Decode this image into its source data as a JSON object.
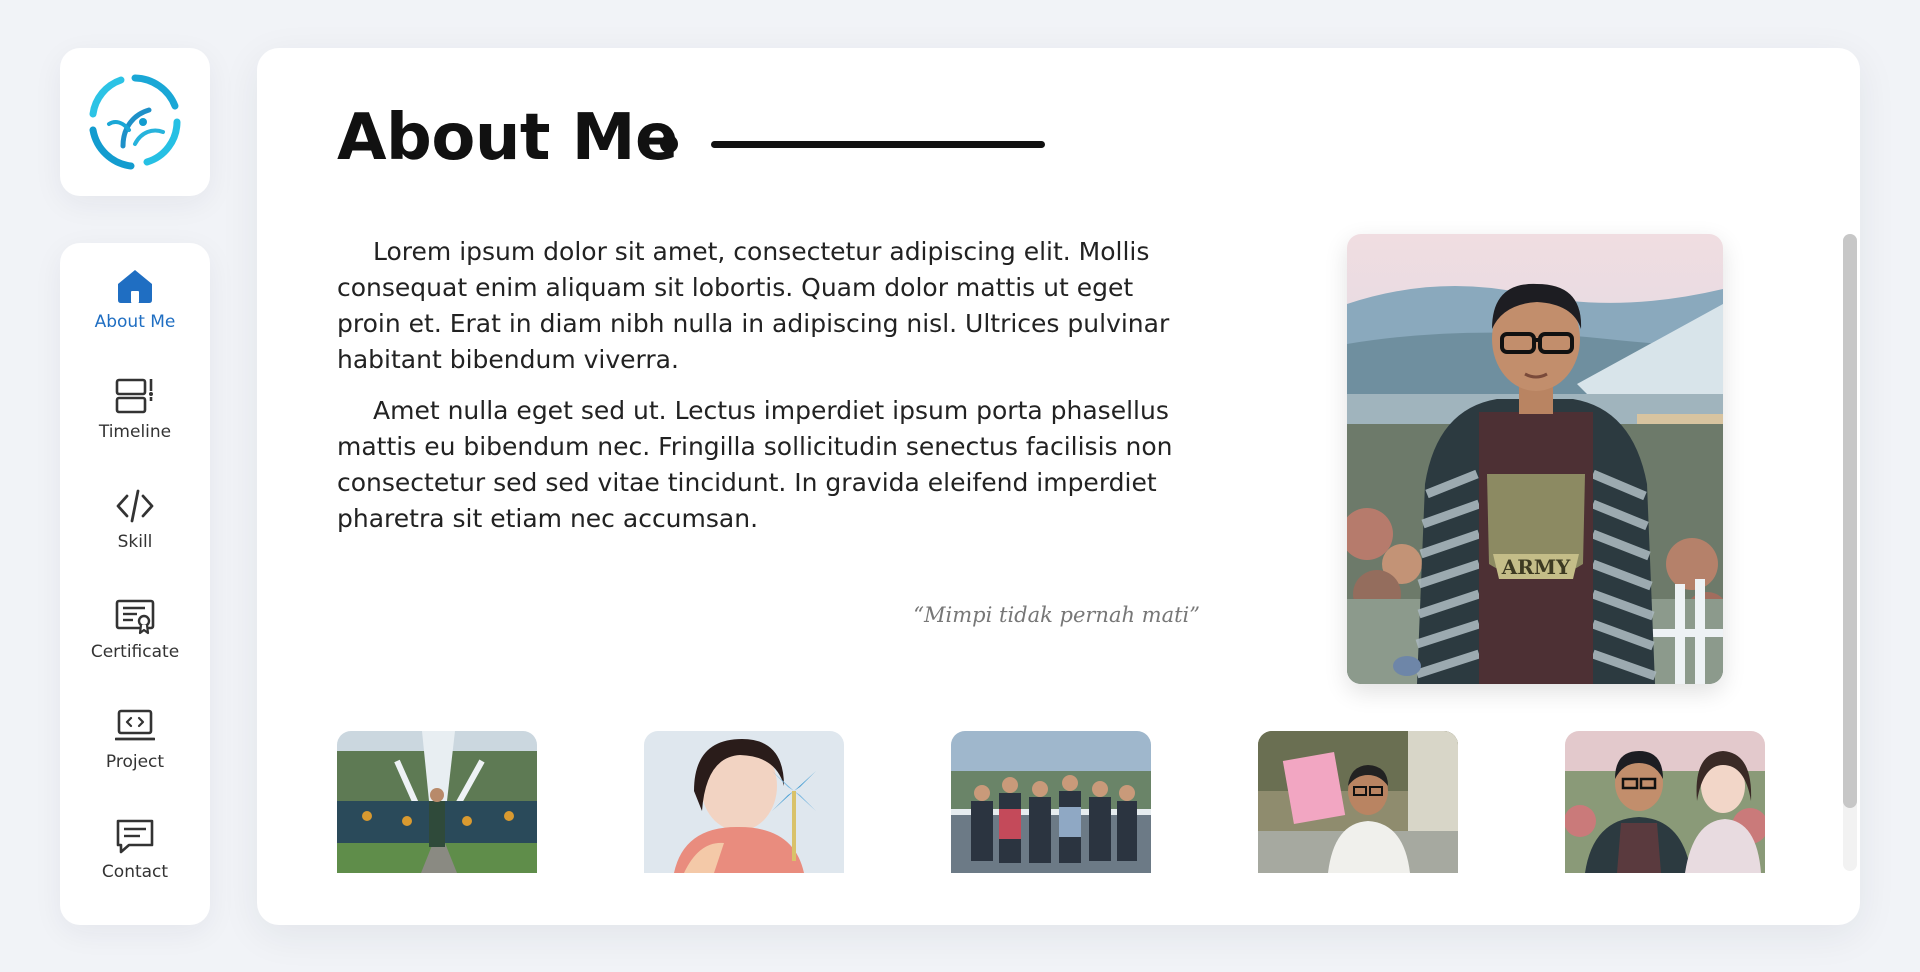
{
  "sidebar": {
    "items": [
      {
        "label": "About Me",
        "icon": "home-icon",
        "active": true
      },
      {
        "label": "Timeline",
        "icon": "timeline-icon",
        "active": false
      },
      {
        "label": "Skill",
        "icon": "code-icon",
        "active": false
      },
      {
        "label": "Certificate",
        "icon": "certificate-icon",
        "active": false
      },
      {
        "label": "Project",
        "icon": "laptop-code-icon",
        "active": false
      },
      {
        "label": "Contact",
        "icon": "chat-icon",
        "active": false
      }
    ]
  },
  "main": {
    "title": "About Me",
    "paragraphs": [
      "Lorem ipsum dolor sit amet, consectetur adipiscing elit. Mollis consequat enim aliquam sit lobortis. Quam dolor mattis ut eget proin et. Erat in diam nibh nulla in adipiscing nisl. Ultrices pulvinar habitant bibendum viverra.",
      "Amet nulla eget sed ut. Lectus imperdiet ipsum porta phasellus mattis eu bibendum nec. Fringilla sollicitudin senectus facilisis non consectetur sed sed vitae tincidunt. In gravida eleifend imperdiet pharetra sit etiam nec accumsan."
    ],
    "quote": "“Mimpi tidak pernah mati”",
    "army_label": "ARMY"
  },
  "colors": {
    "accent": "#1f6ec2",
    "background": "#f1f3f7",
    "card": "#ffffff",
    "text": "#222222"
  }
}
